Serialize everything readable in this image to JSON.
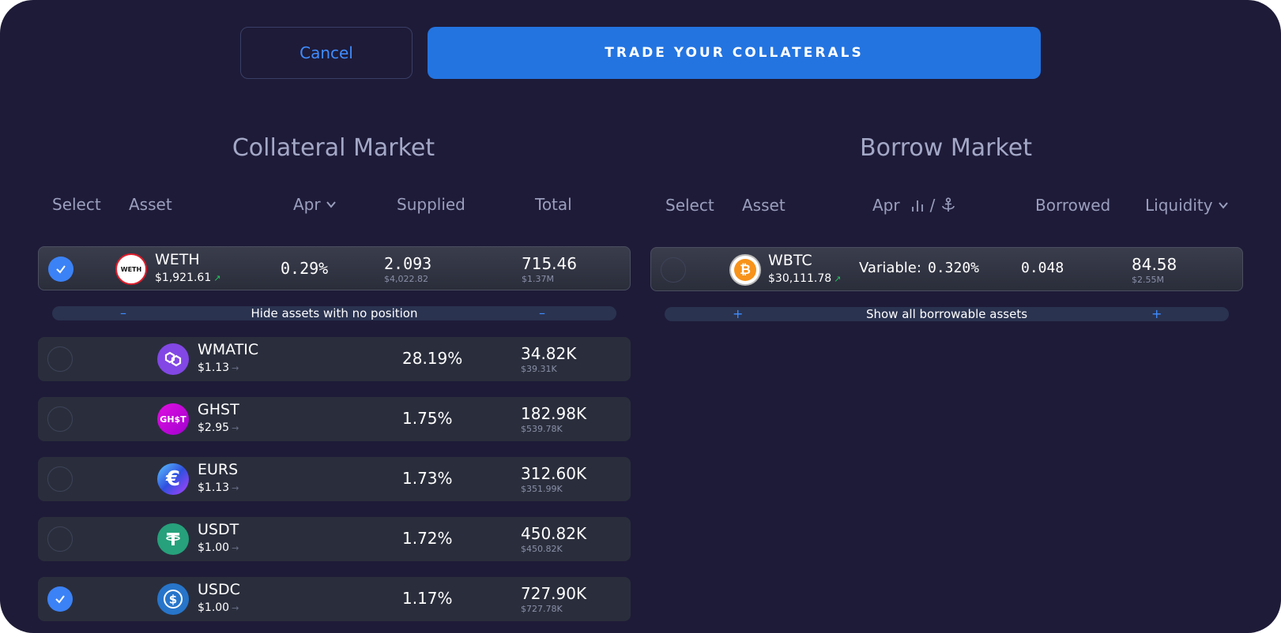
{
  "actions": {
    "cancel_label": "Cancel",
    "trade_label": "TRADE YOUR COLLATERALS"
  },
  "collateral_market": {
    "title": "Collateral Market",
    "headers": {
      "select": "Select",
      "asset": "Asset",
      "apr": "Apr",
      "supplied": "Supplied",
      "total": "Total"
    },
    "position_rows": [
      {
        "symbol": "WETH",
        "logo_text": "WETH",
        "price": "$1,921.61",
        "apr": "0.29%",
        "supplied": "2.093",
        "supplied_usd": "$4,022.82",
        "total": "715.46",
        "total_usd": "$1.37M",
        "selected": true
      }
    ],
    "toggle": {
      "label": "Hide assets with no position",
      "symbol": "–"
    },
    "other_rows": [
      {
        "symbol": "WMATIC",
        "price": "$1.13",
        "apr": "28.19%",
        "total": "34.82K",
        "total_usd": "$39.31K",
        "selected": false
      },
      {
        "symbol": "GHST",
        "logo_text": "GH$T",
        "price": "$2.95",
        "apr": "1.75%",
        "total": "182.98K",
        "total_usd": "$539.78K",
        "selected": false
      },
      {
        "symbol": "EURS",
        "price": "$1.13",
        "apr": "1.73%",
        "total": "312.60K",
        "total_usd": "$351.99K",
        "selected": false
      },
      {
        "symbol": "USDT",
        "price": "$1.00",
        "apr": "1.72%",
        "total": "450.82K",
        "total_usd": "$450.82K",
        "selected": false
      },
      {
        "symbol": "USDC",
        "price": "$1.00",
        "apr": "1.17%",
        "total": "727.90K",
        "total_usd": "$727.78K",
        "selected": true
      }
    ]
  },
  "borrow_market": {
    "title": "Borrow Market",
    "headers": {
      "select": "Select",
      "asset": "Asset",
      "apr": "Apr",
      "apr_separator": "/",
      "borrowed": "Borrowed",
      "liquidity": "Liquidity"
    },
    "rows": [
      {
        "symbol": "WBTC",
        "price": "$30,111.78",
        "rate_label": "Variable:",
        "rate": "0.320%",
        "borrowed": "0.048",
        "liquidity": "84.58",
        "liquidity_usd": "$2.55M",
        "selected": false
      }
    ],
    "toggle": {
      "label": "Show all borrowable assets",
      "symbol": "+"
    }
  },
  "colors": {
    "background": "#1e1b38",
    "accent": "#2374e1",
    "up_arrow": "#22c55e",
    "selected": "#3b82f6"
  }
}
